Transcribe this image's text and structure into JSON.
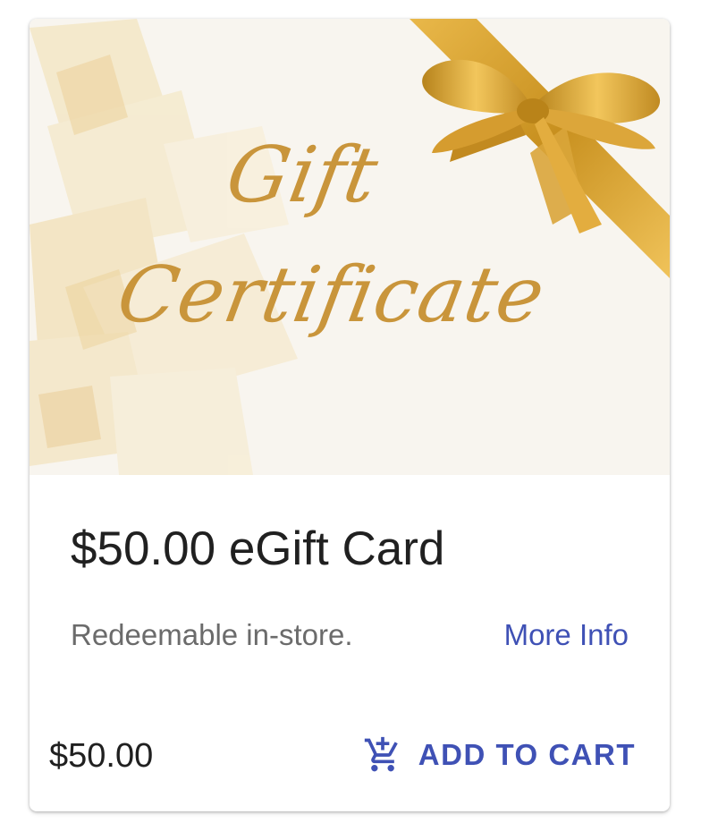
{
  "product": {
    "image": {
      "alt": "Gift Certificate",
      "line1": "Gift",
      "line2": "Certificate"
    },
    "title": "$50.00 eGift Card",
    "description": "Redeemable in-store.",
    "more_info_label": "More Info",
    "price": "$50.00",
    "add_to_cart_label": "ADD TO CART",
    "add_to_cart_icon": "add-shopping-cart-icon"
  },
  "colors": {
    "accent": "#3f51b5",
    "title": "#202020",
    "muted_text": "#6b6b6b",
    "gold": "#c9953b",
    "image_background": "#f8f5ef"
  }
}
